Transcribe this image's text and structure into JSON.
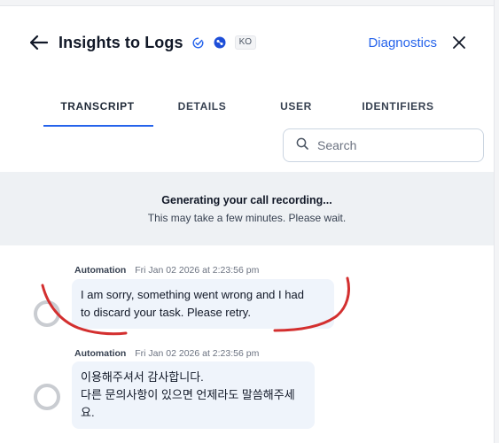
{
  "header": {
    "title": "Insights to Logs",
    "lang_badge": "KO",
    "diagnostics_label": "Diagnostics"
  },
  "tabs": [
    {
      "label": "TRANSCRIPT"
    },
    {
      "label": "DETAILS"
    },
    {
      "label": "USER"
    },
    {
      "label": "IDENTIFIERS"
    }
  ],
  "search": {
    "placeholder": "Search"
  },
  "banner": {
    "title": "Generating your call recording...",
    "subtitle": "This may take a few minutes. Please wait."
  },
  "messages": [
    {
      "sender": "Automation",
      "timestamp": "Fri Jan 02 2026 at 2:23:56 pm",
      "lines": [
        "I am sorry, something went wrong and I had",
        "to discard your task. Please retry."
      ]
    },
    {
      "sender": "Automation",
      "timestamp": "Fri Jan 02 2026 at 2:23:56 pm",
      "lines": [
        "이용해주셔서 감사합니다.",
        "다른 문의사항이 있으면 언제라도 말씀해주세요."
      ]
    }
  ],
  "colors": {
    "accent": "#2563eb",
    "annotation": "#d32f2f"
  }
}
